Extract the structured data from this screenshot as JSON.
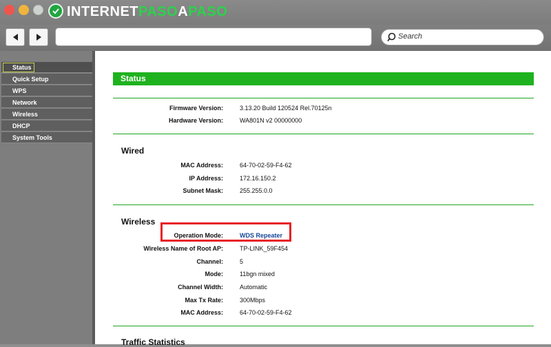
{
  "browser": {
    "logo": {
      "part1": "INTERNET",
      "part2": "PASO",
      "part3": "A",
      "part4": "PASO"
    },
    "search_placeholder": "Search",
    "url": ""
  },
  "sidebar": {
    "items": [
      {
        "label": "Status",
        "active": true
      },
      {
        "label": "Quick Setup"
      },
      {
        "label": "WPS"
      },
      {
        "label": "Network"
      },
      {
        "label": "Wireless"
      },
      {
        "label": "DHCP"
      },
      {
        "label": "System Tools"
      }
    ]
  },
  "status": {
    "title": "Status",
    "firmware_label": "Firmware Version:",
    "firmware_value": "3.13.20 Build 120524 Rel.70125n",
    "hardware_label": "Hardware Version:",
    "hardware_value": "WA801N v2 00000000",
    "wired": {
      "title": "Wired",
      "mac_label": "MAC Address:",
      "mac_value": "64-70-02-59-F4-62",
      "ip_label": "IP Address:",
      "ip_value": "172.16.150.2",
      "mask_label": "Subnet Mask:",
      "mask_value": "255.255.0.0"
    },
    "wireless": {
      "title": "Wireless",
      "opmode_label": "Operation Mode:",
      "opmode_value": "WDS Repeater",
      "rootap_label": "Wireless Name of Root AP:",
      "rootap_value": "TP-LINK_59F454",
      "channel_label": "Channel:",
      "channel_value": "5",
      "mode_label": "Mode:",
      "mode_value": "11bgn mixed",
      "width_label": "Channel Width:",
      "width_value": "Automatic",
      "rate_label": "Max Tx Rate:",
      "rate_value": "300Mbps",
      "mac_label": "MAC Address:",
      "mac_value": "64-70-02-59-F4-62"
    },
    "traffic": {
      "title": "Traffic Statistics"
    }
  },
  "colors": {
    "accent_green": "#1fb21f",
    "highlight_red": "#e81e25",
    "link_blue": "#14469a"
  }
}
